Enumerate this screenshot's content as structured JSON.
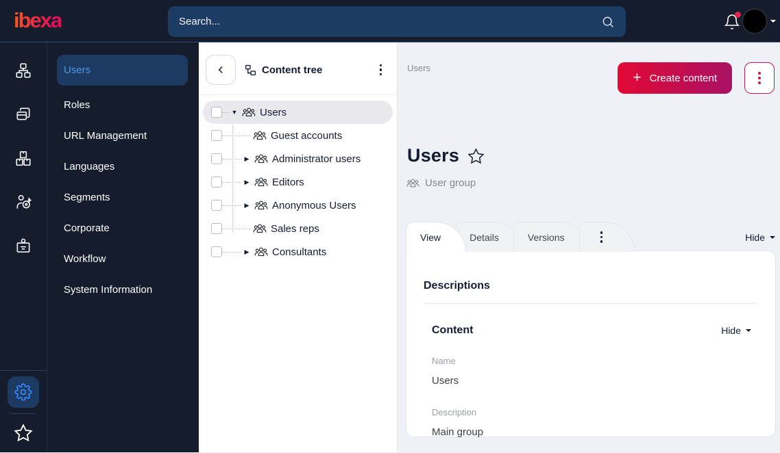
{
  "topbar": {
    "logo_text": "ibexa",
    "search_placeholder": "Search...",
    "icons": [
      "search-icon",
      "notification-bell-icon",
      "avatar",
      "caret-down-icon"
    ],
    "notification_dot_color": "#e0234e"
  },
  "icon_rail": {
    "icons": [
      "content-structure-icon",
      "pages-icon",
      "product-catalog-icon",
      "personalization-icon",
      "admin-icon",
      "settings-gear-icon",
      "bookmarks-star-icon"
    ]
  },
  "sidebar": {
    "items": [
      {
        "label": "Users",
        "active": true
      },
      {
        "label": "Roles",
        "active": false
      },
      {
        "label": "URL Management",
        "active": false
      },
      {
        "label": "Languages",
        "active": false
      },
      {
        "label": "Segments",
        "active": false
      },
      {
        "label": "Corporate",
        "active": false
      },
      {
        "label": "Workflow",
        "active": false
      },
      {
        "label": "System Information",
        "active": false
      }
    ]
  },
  "content_tree": {
    "title": "Content tree",
    "items": [
      {
        "label": "Users",
        "caret": "▼",
        "selected": true,
        "depth": 0
      },
      {
        "label": "Guest accounts",
        "caret": "",
        "selected": false,
        "depth": 1
      },
      {
        "label": "Administrator users",
        "caret": "▶",
        "selected": false,
        "depth": 1
      },
      {
        "label": "Editors",
        "caret": "▶",
        "selected": false,
        "depth": 1
      },
      {
        "label": "Anonymous Users",
        "caret": "▶",
        "selected": false,
        "depth": 1
      },
      {
        "label": "Sales reps",
        "caret": "",
        "selected": false,
        "depth": 1
      },
      {
        "label": "Consultants",
        "caret": "▶",
        "selected": false,
        "depth": 1
      }
    ]
  },
  "main": {
    "breadcrumb": "Users",
    "create_button": "Create content",
    "title": "Users",
    "content_type": "User group",
    "tabs": [
      {
        "label": "View",
        "active": true
      },
      {
        "label": "Details",
        "active": false
      },
      {
        "label": "Versions",
        "active": false
      }
    ],
    "hide_toggle": "Hide",
    "card": {
      "section_title": "Descriptions",
      "content_heading": "Content",
      "content_hide": "Hide",
      "fields": [
        {
          "label": "Name",
          "value": "Users"
        },
        {
          "label": "Description",
          "value": "Main group"
        }
      ]
    }
  },
  "colors": {
    "topbar_bg": "#151c2c",
    "topbar_divider": "#2d4b7a",
    "active_item_bg": "#1d3a63",
    "active_item_text": "#4c97e9",
    "accent_gradient_start": "#e20935",
    "accent_gradient_end": "#aa1164",
    "kebab_accent": "#c2175b",
    "main_bg": "#eef1f6",
    "text_dark": "#131c33",
    "text_gray": "#878b90"
  }
}
